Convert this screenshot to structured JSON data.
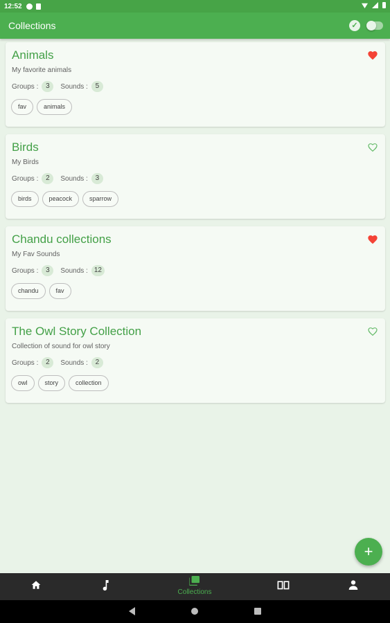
{
  "status_bar": {
    "time": "12:52"
  },
  "appbar": {
    "title": "Collections"
  },
  "collections": [
    {
      "name": "Animals",
      "description": "My favorite animals",
      "groups_label": "Groups :",
      "groups": "3",
      "sounds_label": "Sounds :",
      "sounds": "5",
      "tags": [
        "fav",
        "animals"
      ],
      "favorite": true
    },
    {
      "name": "Birds",
      "description": "My Birds",
      "groups_label": "Groups :",
      "groups": "2",
      "sounds_label": "Sounds :",
      "sounds": "3",
      "tags": [
        "birds",
        "peacock",
        "sparrow"
      ],
      "favorite": false
    },
    {
      "name": "Chandu collections",
      "description": "My Fav Sounds",
      "groups_label": "Groups :",
      "groups": "3",
      "sounds_label": "Sounds :",
      "sounds": "12",
      "tags": [
        "chandu",
        "fav"
      ],
      "favorite": true
    },
    {
      "name": "The Owl Story Collection",
      "description": "Collection of sound for owl story",
      "groups_label": "Groups :",
      "groups": "2",
      "sounds_label": "Sounds :",
      "sounds": "2",
      "tags": [
        "owl",
        "story",
        "collection"
      ],
      "favorite": false
    }
  ],
  "fab": {
    "label": "+"
  },
  "bottom_nav": {
    "items": [
      {
        "icon": "home-icon"
      },
      {
        "icon": "music-note-icon"
      },
      {
        "icon": "collections-icon",
        "label": "Collections",
        "active": true
      },
      {
        "icon": "book-icon"
      },
      {
        "icon": "person-icon"
      }
    ]
  },
  "colors": {
    "primary": "#4caf50",
    "heart_red": "#f44336",
    "background": "#e9f3e8"
  }
}
